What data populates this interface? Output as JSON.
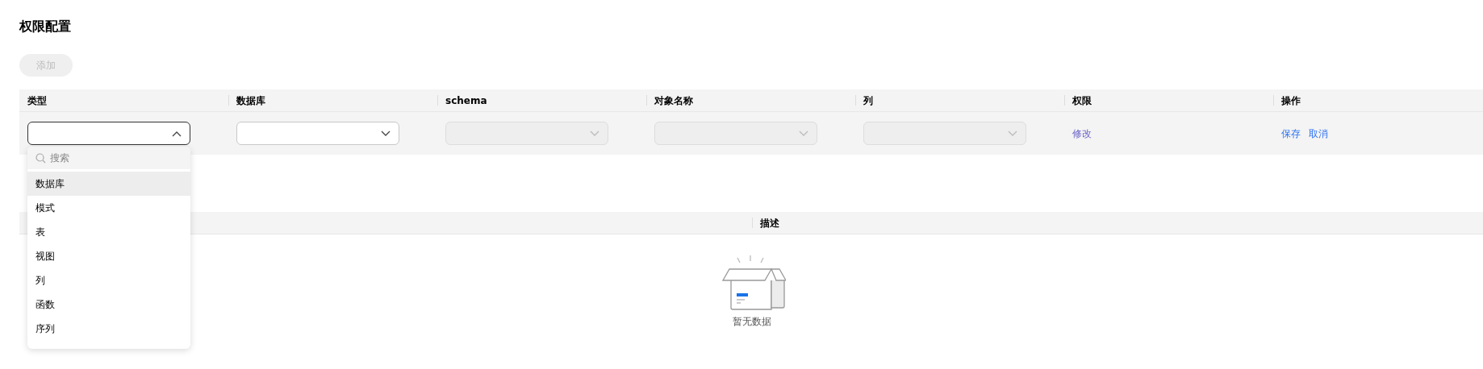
{
  "page_title": "权限配置",
  "add_button": {
    "label": "添加",
    "disabled": true
  },
  "permission_table": {
    "columns": [
      "类型",
      "数据库",
      "schema",
      "对象名称",
      "列",
      "权限",
      "操作"
    ],
    "edit_row": {
      "selects": [
        {
          "open": true,
          "disabled": false
        },
        {
          "open": false,
          "disabled": false
        },
        {
          "open": false,
          "disabled": true
        },
        {
          "open": false,
          "disabled": true
        },
        {
          "open": false,
          "disabled": true
        }
      ],
      "permission_link": "修改",
      "actions": [
        "保存",
        "取消"
      ]
    }
  },
  "dropdown": {
    "search_placeholder": "搜索",
    "options": [
      {
        "label": "数据库",
        "selected": true
      },
      {
        "label": "模式",
        "selected": false
      },
      {
        "label": "表",
        "selected": false
      },
      {
        "label": "视图",
        "selected": false
      },
      {
        "label": "列",
        "selected": false
      },
      {
        "label": "函数",
        "selected": false
      },
      {
        "label": "序列",
        "selected": false
      }
    ]
  },
  "second_table": {
    "columns": [
      "描述"
    ],
    "empty_text": "暂无数据"
  }
}
